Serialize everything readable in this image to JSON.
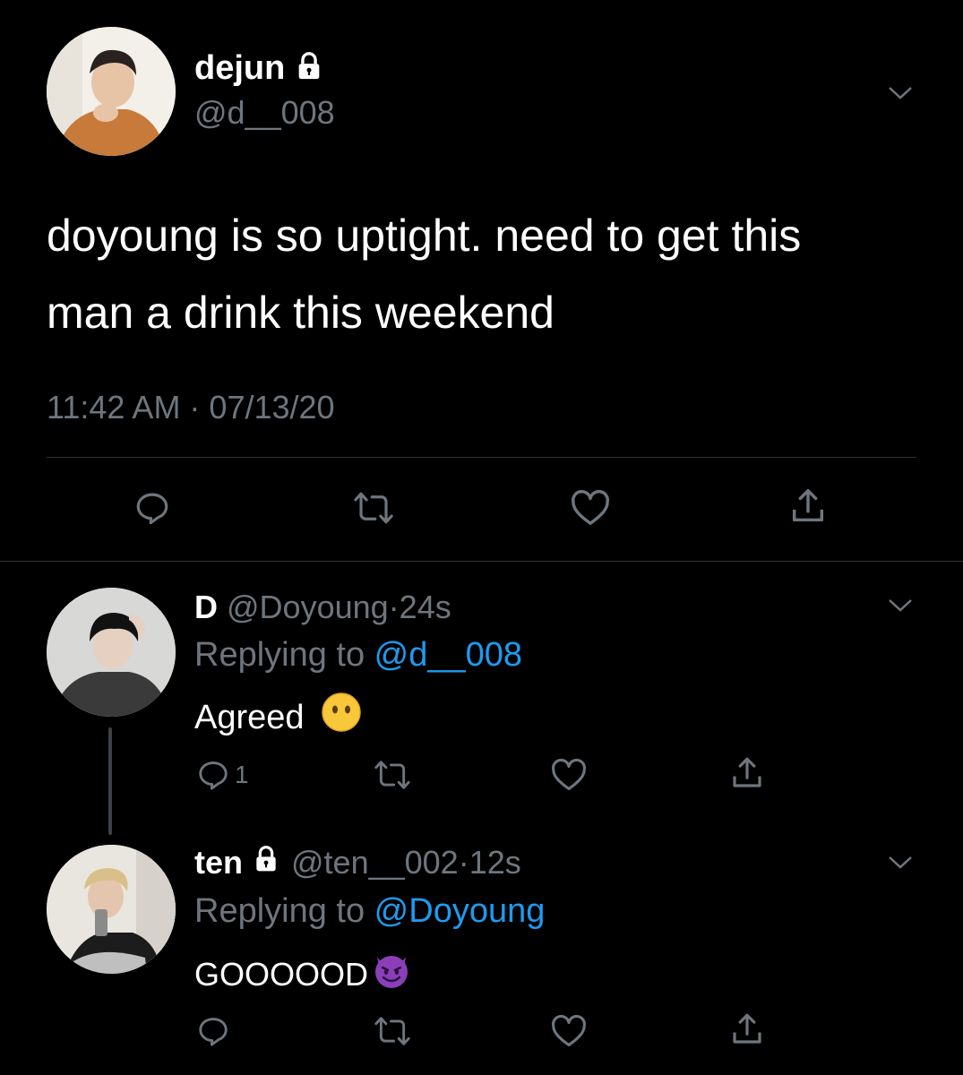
{
  "main_tweet": {
    "display_name": "dejun",
    "handle": "@d__008",
    "text_line1": "doyoung is so uptight. need to get this",
    "text_line2": "man a drink this weekend",
    "timestamp": "11:42 AM · 07/13/20",
    "avatar": "avatar-person-orange-sweater",
    "locked": true
  },
  "replies": [
    {
      "display_name": "D",
      "handle": "@Doyoung",
      "separator": "·",
      "time": "24s",
      "replying_prefix": "Replying to ",
      "replying_to": "@d__008",
      "text": "Agreed",
      "emoji": "face-without-mouth",
      "reply_count": "1",
      "locked": false
    },
    {
      "display_name": "ten",
      "handle": "@ten__002",
      "separator": "·",
      "time": "12s",
      "replying_prefix": "Replying to ",
      "replying_to": "@Doyoung",
      "text": "GOOOOOD",
      "emoji": "smiling-devil",
      "reply_count": "",
      "locked": true
    }
  ],
  "colors": {
    "background": "#000000",
    "text": "#ffffff",
    "secondary": "#6e767d",
    "link": "#1d9bf0",
    "divider": "#2f3336"
  },
  "icons": [
    "lock-icon",
    "chevron-down-icon",
    "reply-icon",
    "retweet-icon",
    "like-icon",
    "share-icon"
  ]
}
